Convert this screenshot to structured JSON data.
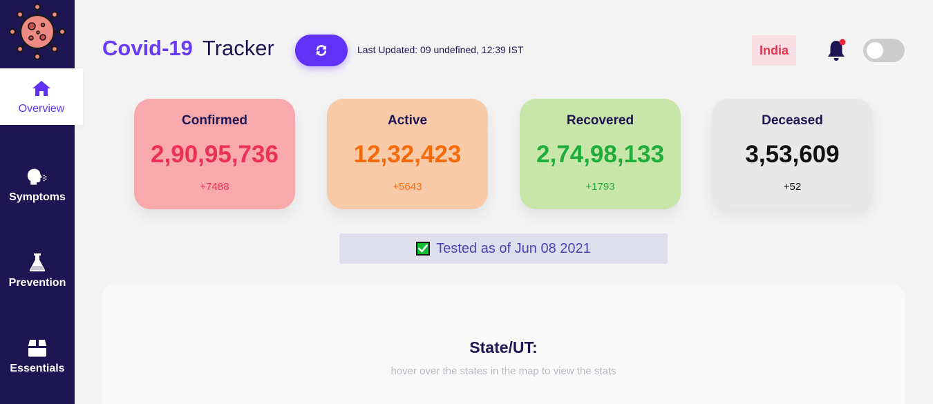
{
  "sidebar": {
    "logo_icon": "virus-icon",
    "items": [
      {
        "label": "Overview",
        "icon": "home-icon",
        "active": true
      },
      {
        "label": "Symptoms",
        "icon": "cough-icon",
        "active": false
      },
      {
        "label": "Prevention",
        "icon": "flask-icon",
        "active": false
      },
      {
        "label": "Essentials",
        "icon": "box-icon",
        "active": false
      }
    ]
  },
  "header": {
    "title_part1": "Covid-19",
    "title_part2": "Tracker",
    "refresh_icon": "refresh-icon",
    "last_updated": "Last Updated: 09 undefined, 12:39 IST",
    "country": "India",
    "bell_icon": "bell-icon",
    "theme_toggle_on": false
  },
  "cards": [
    {
      "label": "Confirmed",
      "value": "2,90,95,736",
      "delta": "+7488",
      "bg": "#f7a9ab",
      "color": "#ec3253"
    },
    {
      "label": "Active",
      "value": "12,32,423",
      "delta": "+5643",
      "bg": "#f8caa8",
      "color": "#f56b0b"
    },
    {
      "label": "Recovered",
      "value": "2,74,98,133",
      "delta": "+1793",
      "bg": "#c8e5aa",
      "color": "#1fad3b"
    },
    {
      "label": "Deceased",
      "value": "3,53,609",
      "delta": "+52",
      "bg": "#e8e8e9",
      "color": "#111111"
    }
  ],
  "tested": {
    "icon": "check-box-icon",
    "text": "Tested as of Jun 08 2021"
  },
  "state_panel": {
    "title": "State/UT:",
    "hint": "hover over the states in the map to view the stats"
  },
  "colors": {
    "sidebar_bg": "#1e1553",
    "accent": "#6231f7",
    "background": "#f4f4f5"
  }
}
